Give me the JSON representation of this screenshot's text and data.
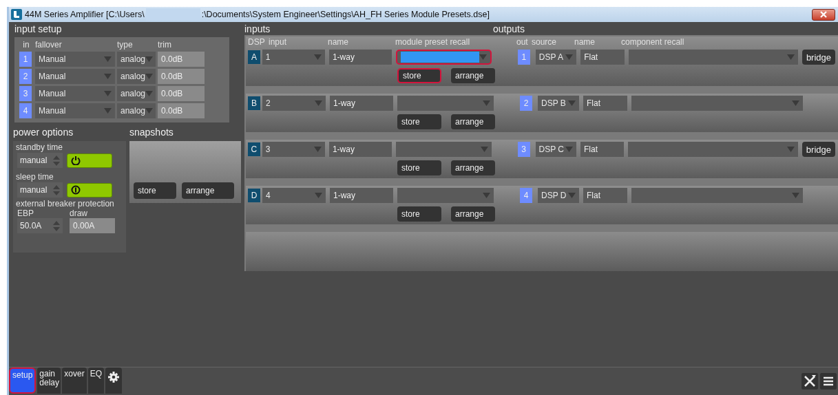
{
  "window": {
    "title_start": "44M Series Amplifier [C:\\Users\\",
    "title_end": ":\\Documents\\System Engineer\\Settings\\AH_FH Series Module Presets.dse]"
  },
  "input_setup": {
    "title": "input setup",
    "columns": [
      "in",
      "fallover",
      "type",
      "trim"
    ],
    "rows": [
      {
        "in": "1",
        "fallover": "Manual",
        "type": "analog",
        "trim": "0.0dB"
      },
      {
        "in": "2",
        "fallover": "Manual",
        "type": "analog",
        "trim": "0.0dB"
      },
      {
        "in": "3",
        "fallover": "Manual",
        "type": "analog",
        "trim": "0.0dB"
      },
      {
        "in": "4",
        "fallover": "Manual",
        "type": "analog",
        "trim": "0.0dB"
      }
    ]
  },
  "power_options": {
    "title": "power options",
    "standby_label": "standby time",
    "standby_value": "manual",
    "sleep_label": "sleep time",
    "sleep_value": "manual",
    "ebp_title": "external breaker protection",
    "ebp_label": "EBP",
    "ebp_value": "50.0A",
    "draw_label": "draw",
    "draw_value": "0.00A"
  },
  "snapshots": {
    "title": "snapshots",
    "buttons": [
      "store",
      "arrange"
    ]
  },
  "inputs": {
    "title": "inputs",
    "columns": [
      "DSP",
      "input",
      "name",
      "module preset recall"
    ],
    "rows": [
      {
        "dsp": "A",
        "input": "1",
        "name": "1-way",
        "preset_selected": true,
        "preset_highlighted": true,
        "store": "store",
        "store_highlighted": true,
        "arrange": "arrange"
      },
      {
        "dsp": "B",
        "input": "2",
        "name": "1-way",
        "preset_selected": false,
        "preset_highlighted": false,
        "store": "store",
        "store_highlighted": false,
        "arrange": "arrange"
      },
      {
        "dsp": "C",
        "input": "3",
        "name": "1-way",
        "preset_selected": false,
        "preset_highlighted": false,
        "store": "store",
        "store_highlighted": false,
        "arrange": "arrange"
      },
      {
        "dsp": "D",
        "input": "4",
        "name": "1-way",
        "preset_selected": false,
        "preset_highlighted": false,
        "store": "store",
        "store_highlighted": false,
        "arrange": "arrange"
      }
    ]
  },
  "outputs": {
    "title": "outputs",
    "columns": [
      "out",
      "source",
      "name",
      "component recall"
    ],
    "rows": [
      {
        "out": "1",
        "source": "DSP A",
        "name": "Flat",
        "bridge": "bridge"
      },
      {
        "out": "2",
        "source": "DSP B",
        "name": "Flat"
      },
      {
        "out": "3",
        "source": "DSP C",
        "name": "Flat",
        "bridge": "bridge"
      },
      {
        "out": "4",
        "source": "DSP D",
        "name": "Flat"
      }
    ]
  },
  "tabs": [
    {
      "kind": "text",
      "label": "setup",
      "selected": true,
      "highlighted": true
    },
    {
      "kind": "text",
      "label": "gain delay",
      "selected": false,
      "highlighted": false
    },
    {
      "kind": "text",
      "label": "xover",
      "selected": false,
      "highlighted": false
    },
    {
      "kind": "text",
      "label": "EQ",
      "selected": false,
      "highlighted": false
    },
    {
      "kind": "gear",
      "selected": false,
      "highlighted": false
    }
  ]
}
